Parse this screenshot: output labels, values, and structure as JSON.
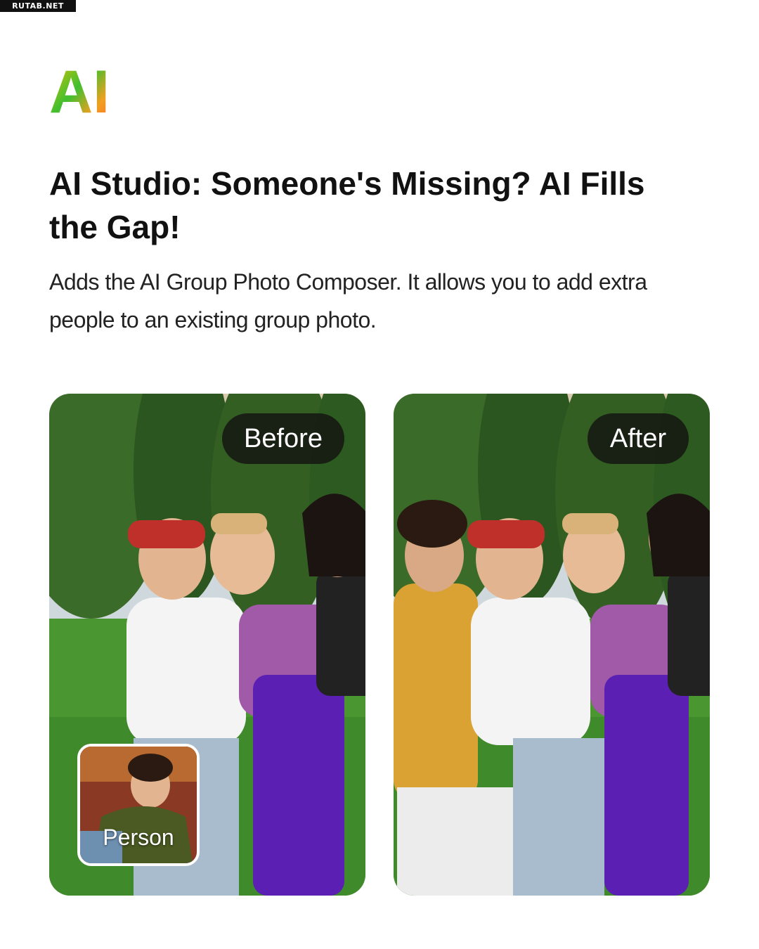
{
  "watermark": "RUTAB.NET",
  "logo": {
    "text": "AI",
    "colors": [
      "#f2c200",
      "#3fbf2f",
      "#ff6a2a"
    ]
  },
  "headline": "AI Studio: Someone's Missing? AI Fills the Gap!",
  "subtitle": "Adds the AI Group Photo Composer. It allows you to add extra people to an existing group photo.",
  "before_card": {
    "tag": "Before",
    "thumbnail_label": "Person"
  },
  "after_card": {
    "tag": "After"
  },
  "colors": {
    "text": "#111111",
    "tag_bg": "#141612",
    "grass": "#3f8a2a",
    "trees": "#2f5a22"
  }
}
